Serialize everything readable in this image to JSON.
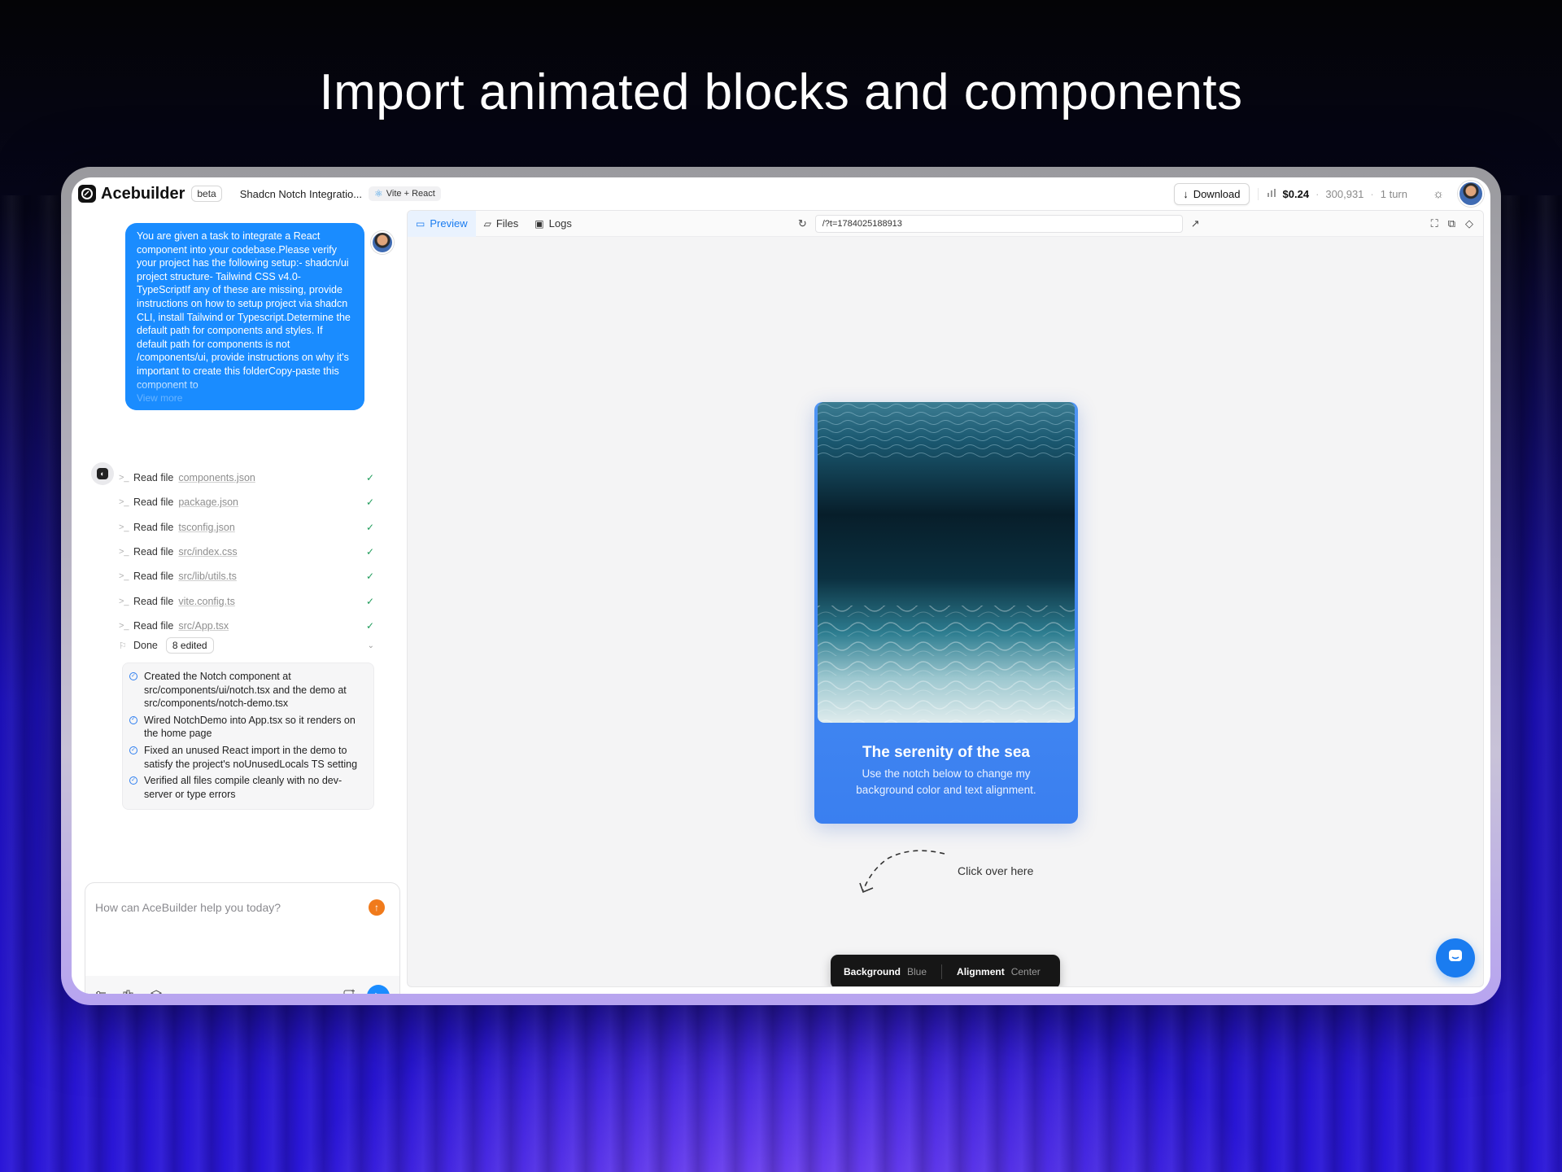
{
  "hero": {
    "title": "Import animated blocks and components"
  },
  "topbar": {
    "brand": "Acebuilder",
    "beta": "beta",
    "project_name": "Shadcn Notch Integratio...",
    "stack": "Vite + React",
    "download": "Download",
    "cost": "$0.24",
    "tokens": "300,931",
    "turns": "1 turn"
  },
  "chat": {
    "user_message": "You are given a task to integrate a React component into your codebase.Please verify your project has the following setup:- shadcn/ui project structure- Tailwind CSS v4.0- TypeScriptIf any of these are missing, provide instructions on how to setup project via shadcn CLI, install Tailwind or Typescript.Determine the default path for components and styles. If default path for components is not /components/ui, provide instructions on why it's important to create this folderCopy-paste this component to",
    "view_more": "View more",
    "steps": [
      {
        "label": "Read file",
        "file": "components.json"
      },
      {
        "label": "Read file",
        "file": "package.json"
      },
      {
        "label": "Read file",
        "file": "tsconfig.json"
      },
      {
        "label": "Read file",
        "file": "src/index.css"
      },
      {
        "label": "Read file",
        "file": "src/lib/utils.ts"
      },
      {
        "label": "Read file",
        "file": "vite.config.ts"
      },
      {
        "label": "Read file",
        "file": "src/App.tsx"
      }
    ],
    "done_label": "Done",
    "edited_badge": "8 edited",
    "summary": [
      "Created the Notch component at src/components/ui/notch.tsx and the demo at src/components/notch-demo.tsx",
      "Wired NotchDemo into App.tsx so it renders on the home page",
      "Fixed an unused React import in the demo to satisfy the project's noUnusedLocals TS setting",
      "Verified all files compile cleanly with no dev-server or type errors"
    ],
    "composer_placeholder": "How can AceBuilder help you today?"
  },
  "preview": {
    "tabs": [
      {
        "label": "Preview",
        "icon": "monitor-icon"
      },
      {
        "label": "Files",
        "icon": "folder-icon"
      },
      {
        "label": "Logs",
        "icon": "terminal-icon"
      }
    ],
    "url": "/?t=1784025188913",
    "card_title": "The serenity of the sea",
    "card_desc": "Use the notch below to change my background color and text alignment.",
    "hint": "Click over here",
    "notch": {
      "background_key": "Background",
      "background_value": "Blue",
      "alignment_key": "Alignment",
      "alignment_value": "Center"
    }
  },
  "colors": {
    "accent": "#1a8cff",
    "card_blue": "#3a7ff0",
    "send_orange": "#f07a1b"
  }
}
